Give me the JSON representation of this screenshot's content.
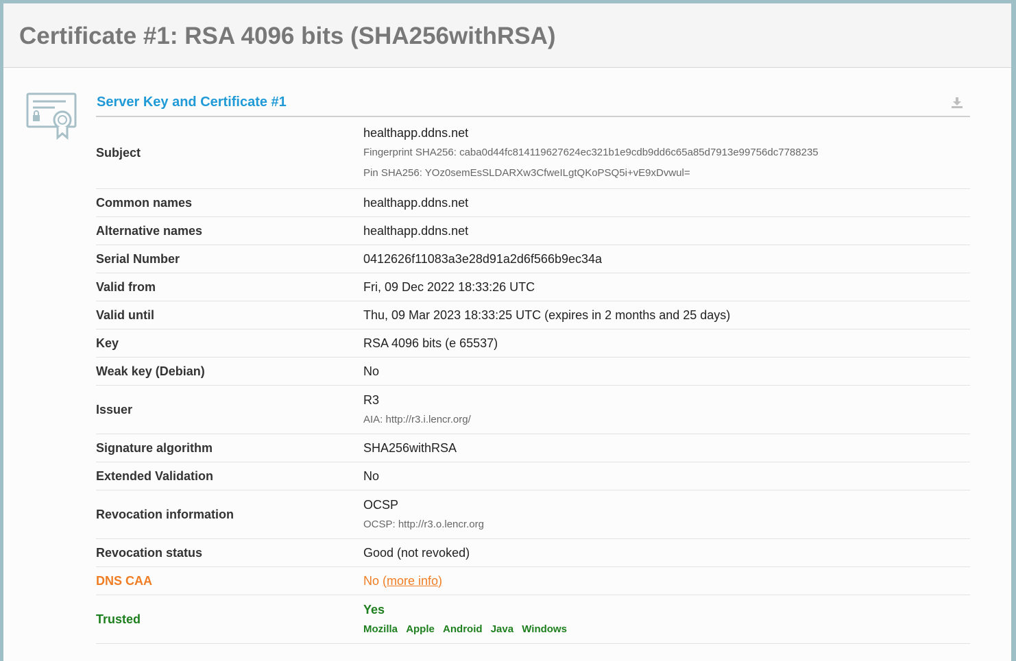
{
  "header": {
    "title": "Certificate #1: RSA 4096 bits (SHA256withRSA)"
  },
  "section": {
    "title": "Server Key and Certificate #1",
    "icon": "certificate-icon",
    "download_icon": "download-icon"
  },
  "colors": {
    "accent": "#1f9ad6",
    "warning": "#f07d24",
    "ok": "#1e7f1e"
  },
  "rows": {
    "subject": {
      "label": "Subject",
      "value": "healthapp.ddns.net",
      "fingerprint": "Fingerprint SHA256: caba0d44fc814119627624ec321b1e9cdb9dd6c65a85d7913e99756dc7788235",
      "pin": "Pin SHA256: YOz0semEsSLDARXw3CfweILgtQKoPSQ5i+vE9xDvwul="
    },
    "common_names": {
      "label": "Common names",
      "value": "healthapp.ddns.net"
    },
    "alternative_names": {
      "label": "Alternative names",
      "value": "healthapp.ddns.net"
    },
    "serial_number": {
      "label": "Serial Number",
      "value": "0412626f11083a3e28d91a2d6f566b9ec34a"
    },
    "valid_from": {
      "label": "Valid from",
      "value": "Fri, 09 Dec 2022 18:33:26 UTC"
    },
    "valid_until": {
      "label": "Valid until",
      "value": "Thu, 09 Mar 2023 18:33:25 UTC (expires in 2 months and 25 days)"
    },
    "key": {
      "label": "Key",
      "value": "RSA 4096 bits (e 65537)"
    },
    "weak_key": {
      "label": "Weak key (Debian)",
      "value": "No"
    },
    "issuer": {
      "label": "Issuer",
      "value": "R3",
      "aia": "AIA: http://r3.i.lencr.org/"
    },
    "signature_algorithm": {
      "label": "Signature algorithm",
      "value": "SHA256withRSA"
    },
    "extended_validation": {
      "label": "Extended Validation",
      "value": "No"
    },
    "revocation_information": {
      "label": "Revocation information",
      "value": "OCSP",
      "ocsp": "OCSP: http://r3.o.lencr.org"
    },
    "revocation_status": {
      "label": "Revocation status",
      "value": "Good (not revoked)"
    },
    "dns_caa": {
      "label": "DNS CAA",
      "value": "No",
      "link": "(more info)"
    },
    "trusted": {
      "label": "Trusted",
      "value": "Yes",
      "stores": [
        "Mozilla",
        "Apple",
        "Android",
        "Java",
        "Windows"
      ]
    }
  }
}
